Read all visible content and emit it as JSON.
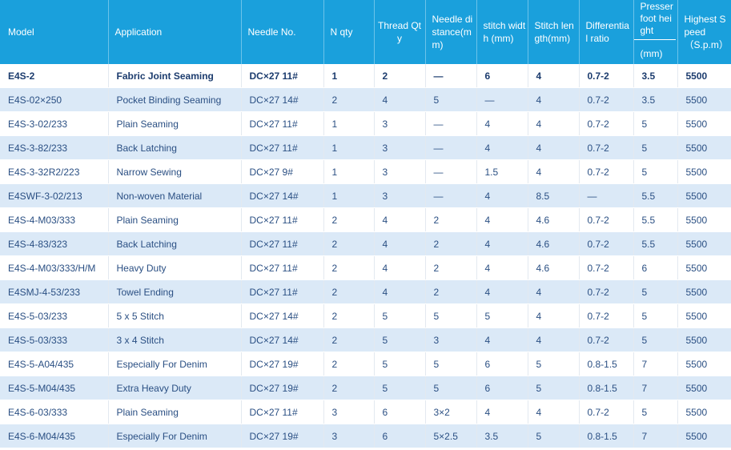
{
  "headers": {
    "model": "Model",
    "application": "Application",
    "needle_no": "Needle No.",
    "n_qty": "N qty",
    "thread_qty": "Thread Qty",
    "needle_distance": "Needle distance(mm)",
    "stitch_width": "stitch width (mm)",
    "stitch_length": "Stitch length(mm)",
    "differential_ratio": "Differential ratio",
    "presser_foot_height": "Presser foot height",
    "presser_unit": "(mm)",
    "highest_speed": "Highest Speed",
    "speed_unit": "（S.p.m）"
  },
  "rows": [
    {
      "model": "E4S-2",
      "application": "Fabric Joint Seaming",
      "needle": "DC×27 11#",
      "n_qty": "1",
      "thread_qty": "2",
      "needle_distance": "—",
      "stitch_width": "6",
      "stitch_length": "4",
      "differential": "0.7-2",
      "presser": "3.5",
      "speed": "5500"
    },
    {
      "model": "E4S-02×250",
      "application": "Pocket Binding Seaming",
      "needle": "DC×27 14#",
      "n_qty": "2",
      "thread_qty": "4",
      "needle_distance": "5",
      "stitch_width": "—",
      "stitch_length": "4",
      "differential": "0.7-2",
      "presser": "3.5",
      "speed": "5500"
    },
    {
      "model": "E4S-3-02/233",
      "application": "Plain Seaming",
      "needle": "DC×27 11#",
      "n_qty": "1",
      "thread_qty": "3",
      "needle_distance": "—",
      "stitch_width": "4",
      "stitch_length": "4",
      "differential": "0.7-2",
      "presser": "5",
      "speed": "5500"
    },
    {
      "model": "E4S-3-82/233",
      "application": "Back Latching",
      "needle": "DC×27 11#",
      "n_qty": "1",
      "thread_qty": "3",
      "needle_distance": "—",
      "stitch_width": "4",
      "stitch_length": "4",
      "differential": "0.7-2",
      "presser": "5",
      "speed": "5500"
    },
    {
      "model": "E4S-3-32R2/223",
      "application": "Narrow Sewing",
      "needle": "DC×27 9#",
      "n_qty": "1",
      "thread_qty": "3",
      "needle_distance": "—",
      "stitch_width": "1.5",
      "stitch_length": "4",
      "differential": "0.7-2",
      "presser": "5",
      "speed": "5500"
    },
    {
      "model": "E4SWF-3-02/213",
      "application": "Non-woven Material",
      "needle": "DC×27 14#",
      "n_qty": "1",
      "thread_qty": "3",
      "needle_distance": "—",
      "stitch_width": "4",
      "stitch_length": "8.5",
      "differential": "—",
      "presser": "5.5",
      "speed": "5500"
    },
    {
      "model": "E4S-4-M03/333",
      "application": "Plain Seaming",
      "needle": "DC×27 11#",
      "n_qty": "2",
      "thread_qty": "4",
      "needle_distance": "2",
      "stitch_width": "4",
      "stitch_length": "4.6",
      "differential": "0.7-2",
      "presser": "5.5",
      "speed": "5500"
    },
    {
      "model": "E4S-4-83/323",
      "application": "Back Latching",
      "needle": "DC×27 11#",
      "n_qty": "2",
      "thread_qty": "4",
      "needle_distance": "2",
      "stitch_width": "4",
      "stitch_length": "4.6",
      "differential": "0.7-2",
      "presser": "5.5",
      "speed": "5500"
    },
    {
      "model": "E4S-4-M03/333/H/M",
      "application": "Heavy Duty",
      "needle": "DC×27 11#",
      "n_qty": "2",
      "thread_qty": "4",
      "needle_distance": "2",
      "stitch_width": "4",
      "stitch_length": "4.6",
      "differential": "0.7-2",
      "presser": "6",
      "speed": "5500"
    },
    {
      "model": "E4SMJ-4-53/233",
      "application": "Towel Ending",
      "needle": "DC×27 11#",
      "n_qty": "2",
      "thread_qty": "4",
      "needle_distance": "2",
      "stitch_width": "4",
      "stitch_length": "4",
      "differential": "0.7-2",
      "presser": "5",
      "speed": "5500"
    },
    {
      "model": "E4S-5-03/233",
      "application": "5 x 5 Stitch",
      "needle": "DC×27 14#",
      "n_qty": "2",
      "thread_qty": "5",
      "needle_distance": "5",
      "stitch_width": "5",
      "stitch_length": "4",
      "differential": "0.7-2",
      "presser": "5",
      "speed": "5500"
    },
    {
      "model": "E4S-5-03/333",
      "application": "3 x 4 Stitch",
      "needle": "DC×27 14#",
      "n_qty": "2",
      "thread_qty": "5",
      "needle_distance": "3",
      "stitch_width": "4",
      "stitch_length": "4",
      "differential": "0.7-2",
      "presser": "5",
      "speed": "5500"
    },
    {
      "model": "E4S-5-A04/435",
      "application": "Especially For Denim",
      "needle": "DC×27 19#",
      "n_qty": "2",
      "thread_qty": "5",
      "needle_distance": "5",
      "stitch_width": "6",
      "stitch_length": "5",
      "differential": "0.8-1.5",
      "presser": "7",
      "speed": "5500"
    },
    {
      "model": "E4S-5-M04/435",
      "application": "Extra Heavy Duty",
      "needle": "DC×27 19#",
      "n_qty": "2",
      "thread_qty": "5",
      "needle_distance": "5",
      "stitch_width": "6",
      "stitch_length": "5",
      "differential": "0.8-1.5",
      "presser": "7",
      "speed": "5500"
    },
    {
      "model": "E4S-6-03/333",
      "application": "Plain Seaming",
      "needle": "DC×27 11#",
      "n_qty": "3",
      "thread_qty": "6",
      "needle_distance": "3×2",
      "stitch_width": "4",
      "stitch_length": "4",
      "differential": "0.7-2",
      "presser": "5",
      "speed": "5500"
    },
    {
      "model": "E4S-6-M04/435",
      "application": "Especially For Denim",
      "needle": "DC×27 19#",
      "n_qty": "3",
      "thread_qty": "6",
      "needle_distance": "5×2.5",
      "stitch_width": "3.5",
      "stitch_length": "5",
      "differential": "0.8-1.5",
      "presser": "7",
      "speed": "5500"
    }
  ]
}
